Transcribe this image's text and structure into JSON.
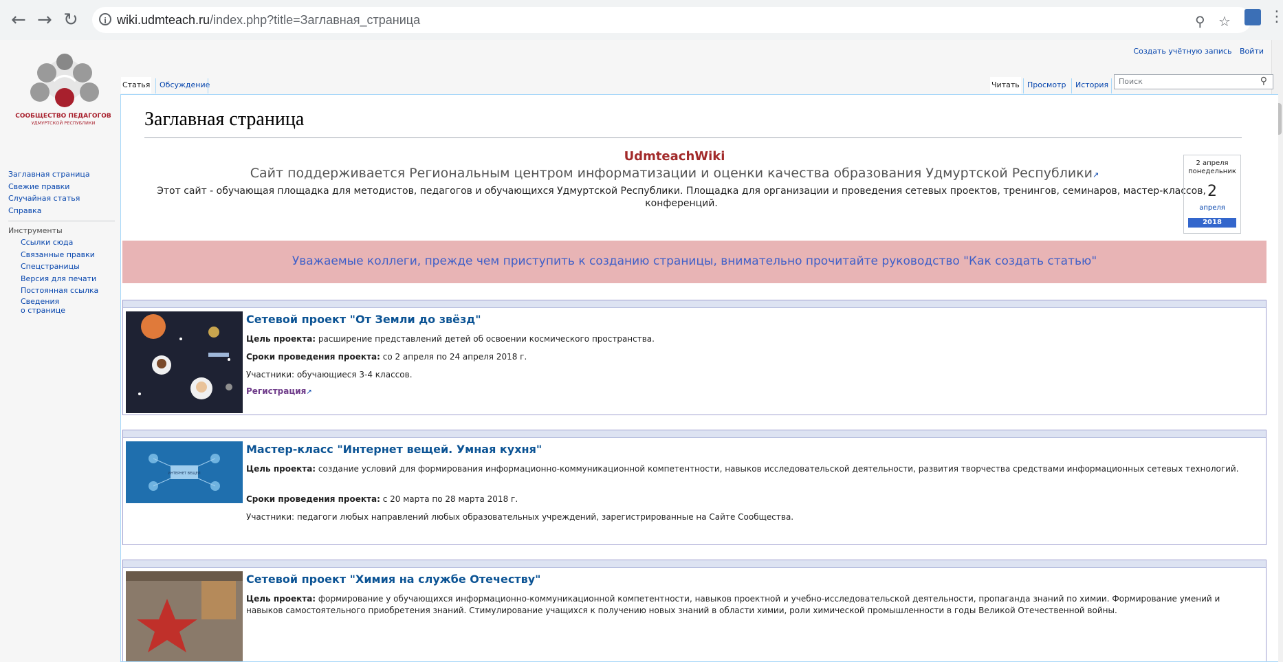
{
  "browser": {
    "url_domain": "wiki.udmteach.ru",
    "url_path": "/index.php?title=Заглавная_страница",
    "info_icon": "info-icon",
    "back_icon": "back-arrow-icon",
    "forward_icon": "forward-arrow-icon",
    "reload_icon": "reload-icon"
  },
  "personal": {
    "create_account": "Создать учётную запись",
    "login": "Войти"
  },
  "logo": {
    "title": "СООБЩЕСТВО ПЕДАГОГОВ",
    "subtitle": "УДМУРТСКОЙ РЕСПУБЛИКИ"
  },
  "sidebar": {
    "nav": [
      "Заглавная страница",
      "Свежие правки",
      "Случайная статья",
      "Справка"
    ],
    "tools_heading": "Инструменты",
    "tools": [
      "Ссылки сюда",
      "Связанные правки",
      "Спецстраницы",
      "Версия для печати",
      "Постоянная ссылка",
      "Сведения",
      "о странице"
    ]
  },
  "tabs": {
    "article": "Статья",
    "discussion": "Обсуждение",
    "read": "Читать",
    "view": "Просмотр",
    "history": "История",
    "search_placeholder": "Поиск"
  },
  "main": {
    "page_title": "Заглавная страница",
    "brand": "UdmteachWiki",
    "tagline": "Сайт поддерживается Региональным центром информатизации и оценки качества образования Удмуртской Республики",
    "description_1": "Этот сайт - обучающая площадка для методистов, педагогов и обучающихся Удмуртской Республики. Площадка для организации и проведения сетевых проектов, тренингов, семинаров, мастер-классов,",
    "description_2": "конференций.",
    "banner": "Уважаемые коллеги, прежде чем приступить к созданию страницы, внимательно прочитайте руководство \"Как создать статью\""
  },
  "calendar": {
    "top_date": "2 апреля",
    "weekday": "понедельник",
    "day": "2",
    "month": "апреля",
    "year": "2018"
  },
  "cards": [
    {
      "title": "Сетевой проект \"От Земли до звёзд\"",
      "goal_label": "Цель проекта:",
      "goal": " расширение представлений детей об освоении космического пространства.",
      "dates_label": "Сроки проведения проекта:",
      "dates": " со 2 апреля по 24 апреля 2018 г.",
      "participants": "Участники: обучающиеся 3-4 классов.",
      "registration": "Регистрация"
    },
    {
      "title": "Мастер-класс \"Интернет вещей. Умная кухня\"",
      "goal_label": "Цель проекта:",
      "goal": " создание условий для формирования информационно-коммуникационной компетентности, навыков исследовательской деятельности, развития творчества средствами информационных сетевых технологий.",
      "dates_label": "Сроки проведения проекта:",
      "dates": " с 20 марта по 28 марта 2018 г.",
      "participants": "Участники: педагоги любых направлений любых образовательных учреждений, зарегистрированные на Сайте Сообщества.",
      "img_label": "ИНТЕРНЕТ ВЕЩЕЙ"
    },
    {
      "title": "Сетевой проект \"Химия на службе Отечеству\"",
      "goal_label": "Цель проекта:",
      "goal": " формирование у обучающихся информационно-коммуникационной компетентности, навыков проектной и учебно-исследовательской деятельности, пропаганда знаний по химии. Формирование умений и навыков самостоятельного приобретения знаний. Стимулирование учащихся к получению новых знаний в области химии, роли химической промышленности в годы Великой Отечественной войны."
    }
  ]
}
